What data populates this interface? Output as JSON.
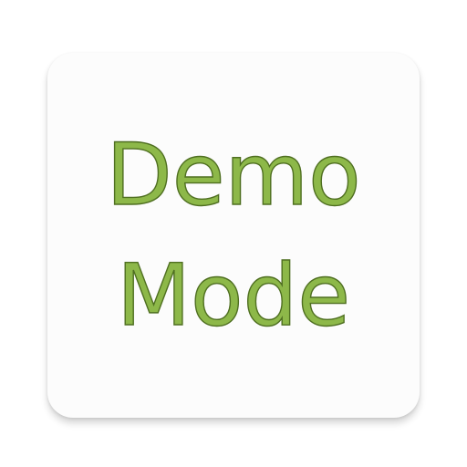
{
  "app_icon": {
    "line_1": "Demo",
    "line_2": "Mode",
    "colors": {
      "tile_background": "#fcfcfc",
      "text_fill": "#8db849",
      "text_outline": "#4f6f21"
    }
  }
}
